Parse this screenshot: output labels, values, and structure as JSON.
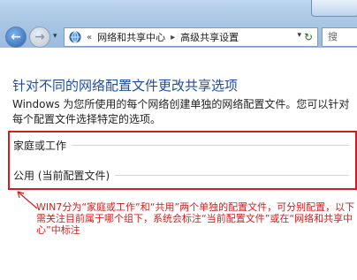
{
  "window": {
    "breadcrumb": {
      "overflow": "«",
      "items": [
        "网络和共享中心",
        "高级共享设置"
      ]
    },
    "search_placeholder": "搜"
  },
  "main": {
    "heading": "针对不同的网络配置文件更改共享选项",
    "description": "Windows 为您所使用的每个网络创建单独的网络配置文件。您可以针对每个配置文件选择特定的选项。",
    "profiles": [
      {
        "label": "家庭或工作"
      },
      {
        "label": "公用 (当前配置文件)"
      }
    ]
  },
  "annotation": {
    "text": "WIN7分为“家庭或工作”和“共用”两个单独的配置文件，可分别配置，以下需关注目前属于哪个组下，系统会标注“当前配置文件”或在“网络和共享中心”中标注"
  },
  "colors": {
    "heading": "#1f4c9c",
    "annotation": "#d41c1c",
    "title_bar": "#a9c6e4"
  },
  "icons": {
    "back": "back-arrow-icon",
    "forward": "forward-arrow-icon",
    "network": "network-icon",
    "refresh": "refresh-icon"
  }
}
